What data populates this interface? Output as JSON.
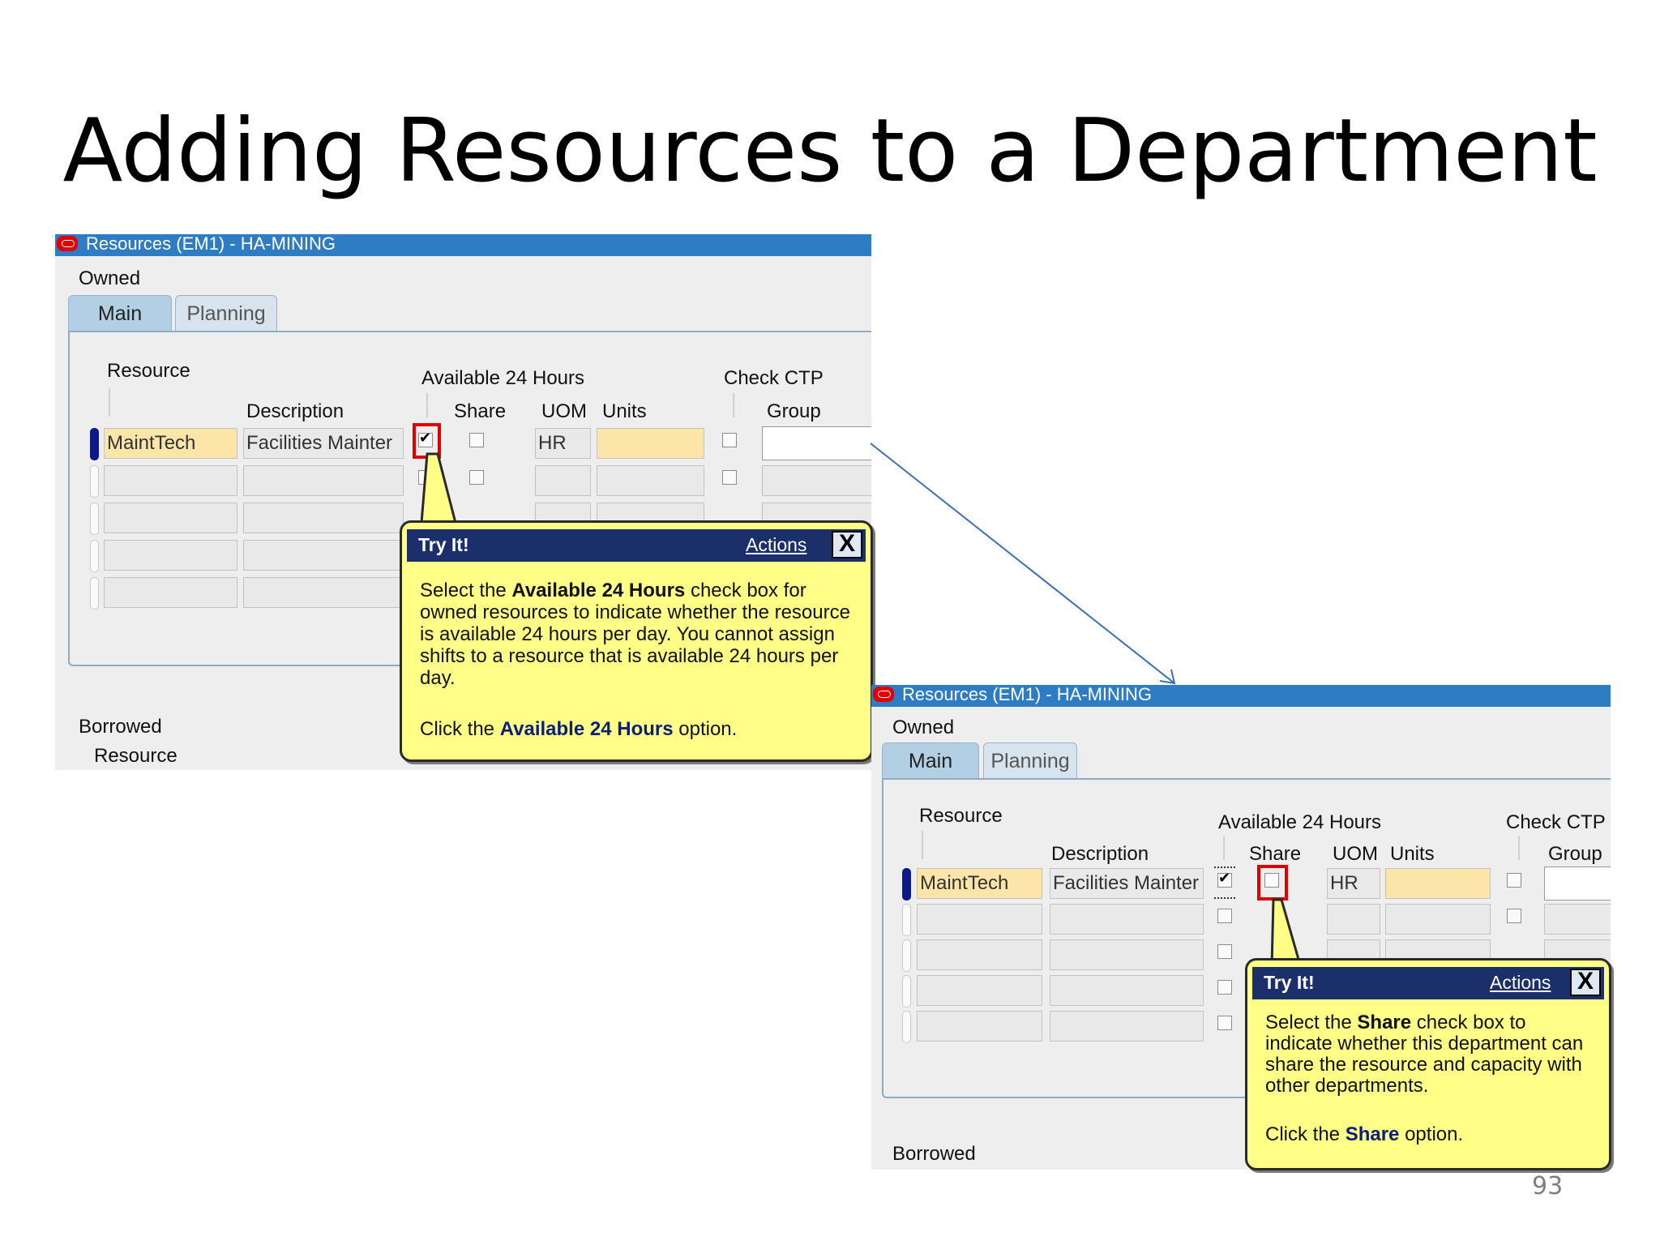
{
  "slide": {
    "title": "Adding Resources to a Department",
    "page_number": "93"
  },
  "window_title": "Resources (EM1) - HA-MINING",
  "labels": {
    "owned": "Owned",
    "borrowed": "Borrowed",
    "borrowed_resource": "Resource",
    "resource": "Resource",
    "description": "Description",
    "available_24_hours": "Available 24 Hours",
    "share": "Share",
    "uom": "UOM",
    "units": "Units",
    "check_ctp": "Check CTP",
    "group": "Group"
  },
  "tabs": {
    "main": "Main",
    "planning": "Planning"
  },
  "row1": {
    "resource": "MaintTech",
    "description": "Facilities Mainter",
    "uom": "HR"
  },
  "callout1": {
    "header": "Try It!",
    "actions": "Actions",
    "close": "X",
    "p1": [
      "Select the ",
      "Available 24 Hours",
      " check box for owned resources to indicate whether the resource is available 24 hours per day. You cannot assign shifts to a resource that is available 24 hours per day."
    ],
    "p2": [
      "Click the ",
      "Available 24 Hours",
      " option."
    ]
  },
  "callout2": {
    "header": "Try It!",
    "actions": "Actions",
    "close": "X",
    "p1": [
      "Select the ",
      "Share",
      " check box to indicate whether this department can share the resource and capacity with other departments."
    ],
    "p2": [
      "Click the ",
      "Share",
      " option."
    ]
  },
  "colors": {
    "titlebar": "#2d7cc4",
    "callout_bg": "#ffff88",
    "callout_header": "#1b2f6b",
    "highlight": "#e00000",
    "arrow": "#3b6fb4"
  }
}
